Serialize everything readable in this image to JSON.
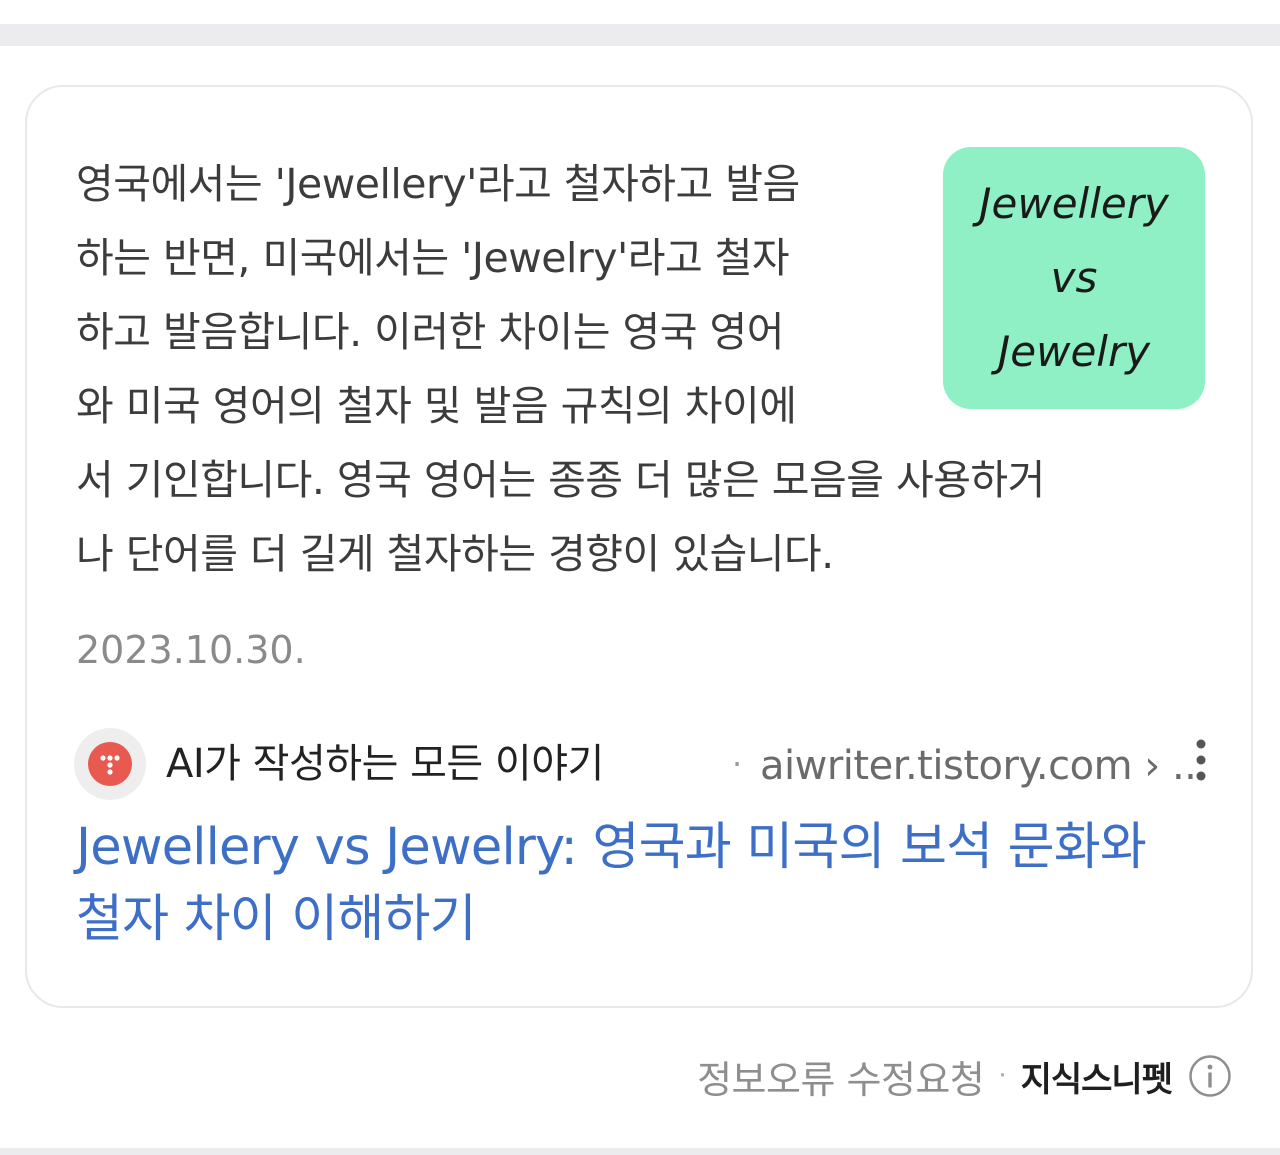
{
  "snippet": {
    "lines": [
      "영국에서는 'Jewellery'라고 철자하고 발음",
      "하는 반면, 미국에서는 'Jewelry'라고 철자",
      "하고 발음합니다. 이러한 차이는 영국 영어",
      "와 미국 영어의 철자 및 발음 규칙의 차이에",
      "서 기인합니다. 영국 영어는 종종 더 많은 모음을 사용하거",
      "나 단어를 더 길게 철자하는 경향이 있습니다."
    ],
    "date": "2023.10.30."
  },
  "thumbnail": {
    "lines": [
      "Jewellery",
      "vs",
      "Jewelry"
    ],
    "background_color": "#8ef0c4"
  },
  "source": {
    "site_name": "AI가 작성하는 모든 이야기",
    "separator": "·",
    "url": "aiwriter.tistory.com › ..",
    "favicon_icon": "tistory-favicon-icon",
    "favicon_color": "#e85a4f",
    "more_icon": "more-vert-icon"
  },
  "result": {
    "title_lines": [
      "Jewellery vs Jewelry: 영국과 미국의 보석 문화와",
      "철자 차이 이해하기"
    ],
    "link_color": "#3d6fc7"
  },
  "footer": {
    "report_label": "정보오류 수정요청",
    "separator": "·",
    "snippet_label": "지식스니펫",
    "info_icon": "info-icon"
  }
}
